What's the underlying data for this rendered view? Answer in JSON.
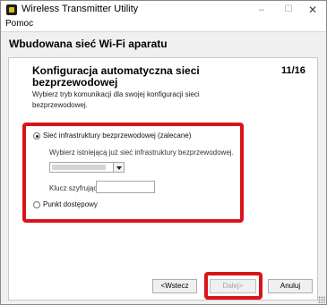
{
  "window": {
    "title": "Wireless Transmitter Utility",
    "controls": {
      "minimize": "–",
      "maximize": "☐",
      "close": "✕"
    }
  },
  "menu": {
    "items": [
      "Pomoc"
    ]
  },
  "header": {
    "title": "Wbudowana sieć Wi-Fi aparatu"
  },
  "step": {
    "title": "Konfiguracja automatyczna sieci bezprzewodowej",
    "counter": "11/16",
    "instruction": "Wybierz tryb komunikacji dla swojej konfiguracji sieci bezprzewodowej."
  },
  "options": {
    "infrastructure": {
      "label": "Sieć infrastruktury bezprzewodowej (zalecane)",
      "selected": true,
      "select_prompt": "Wybierz istniejącą już sieć infrastruktury bezprzewodowej.",
      "network_value": "",
      "key_label": "Klucz szyfrujący",
      "key_value": ""
    },
    "access_point": {
      "label": "Punkt dostępowy",
      "selected": false
    }
  },
  "buttons": {
    "back": "<Wstecz",
    "next": "Dalej>",
    "cancel": "Anuluj"
  },
  "colors": {
    "highlight": "#d8141b",
    "background": "#f0f0f0",
    "panel": "#ffffff"
  }
}
